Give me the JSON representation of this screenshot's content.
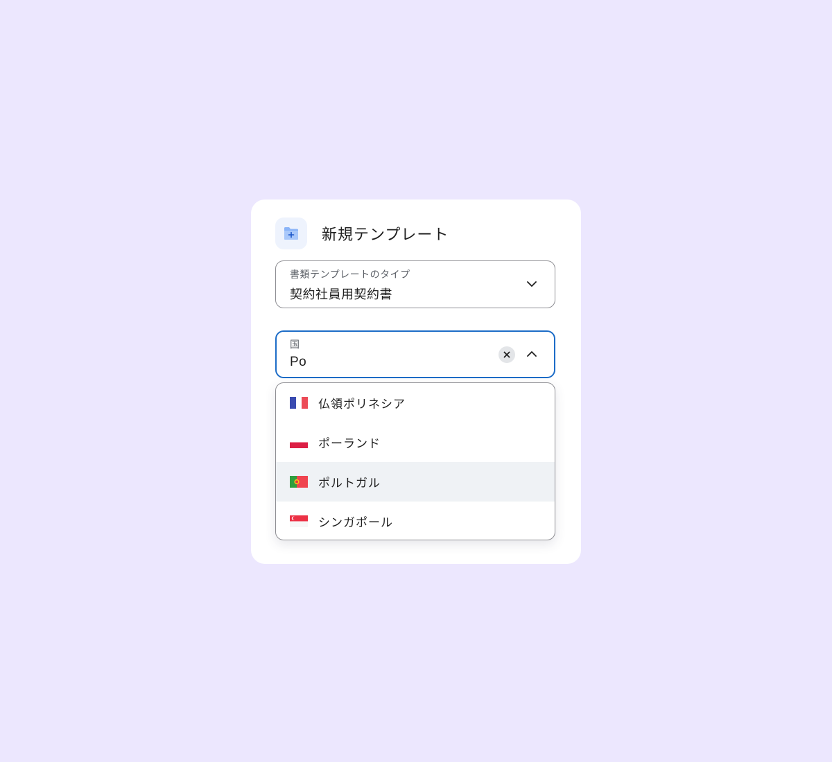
{
  "header": {
    "icon": "folder-plus-icon",
    "title": "新規テンプレート"
  },
  "document_type_field": {
    "label": "書類テンプレートのタイプ",
    "value": "契約社員用契約書",
    "icon": "chevron-down-icon"
  },
  "country_field": {
    "label": "国",
    "value": "Po",
    "clear_icon": "close-icon",
    "toggle_icon": "chevron-up-icon"
  },
  "country_options": [
    {
      "label": "仏領ポリネシア",
      "flag": "france-flag-icon",
      "highlighted": false
    },
    {
      "label": "ポーランド",
      "flag": "poland-flag-icon",
      "highlighted": false
    },
    {
      "label": "ポルトガル",
      "flag": "portugal-flag-icon",
      "highlighted": true
    },
    {
      "label": "シンガポール",
      "flag": "singapore-flag-icon",
      "highlighted": false
    }
  ],
  "colors": {
    "background": "#ece7fe",
    "card": "#ffffff",
    "focus_border": "#1c6cc7",
    "highlight_row": "#eff2f5",
    "icon_bg": "#eef3fd",
    "folder_icon": "#8ab4f8"
  }
}
